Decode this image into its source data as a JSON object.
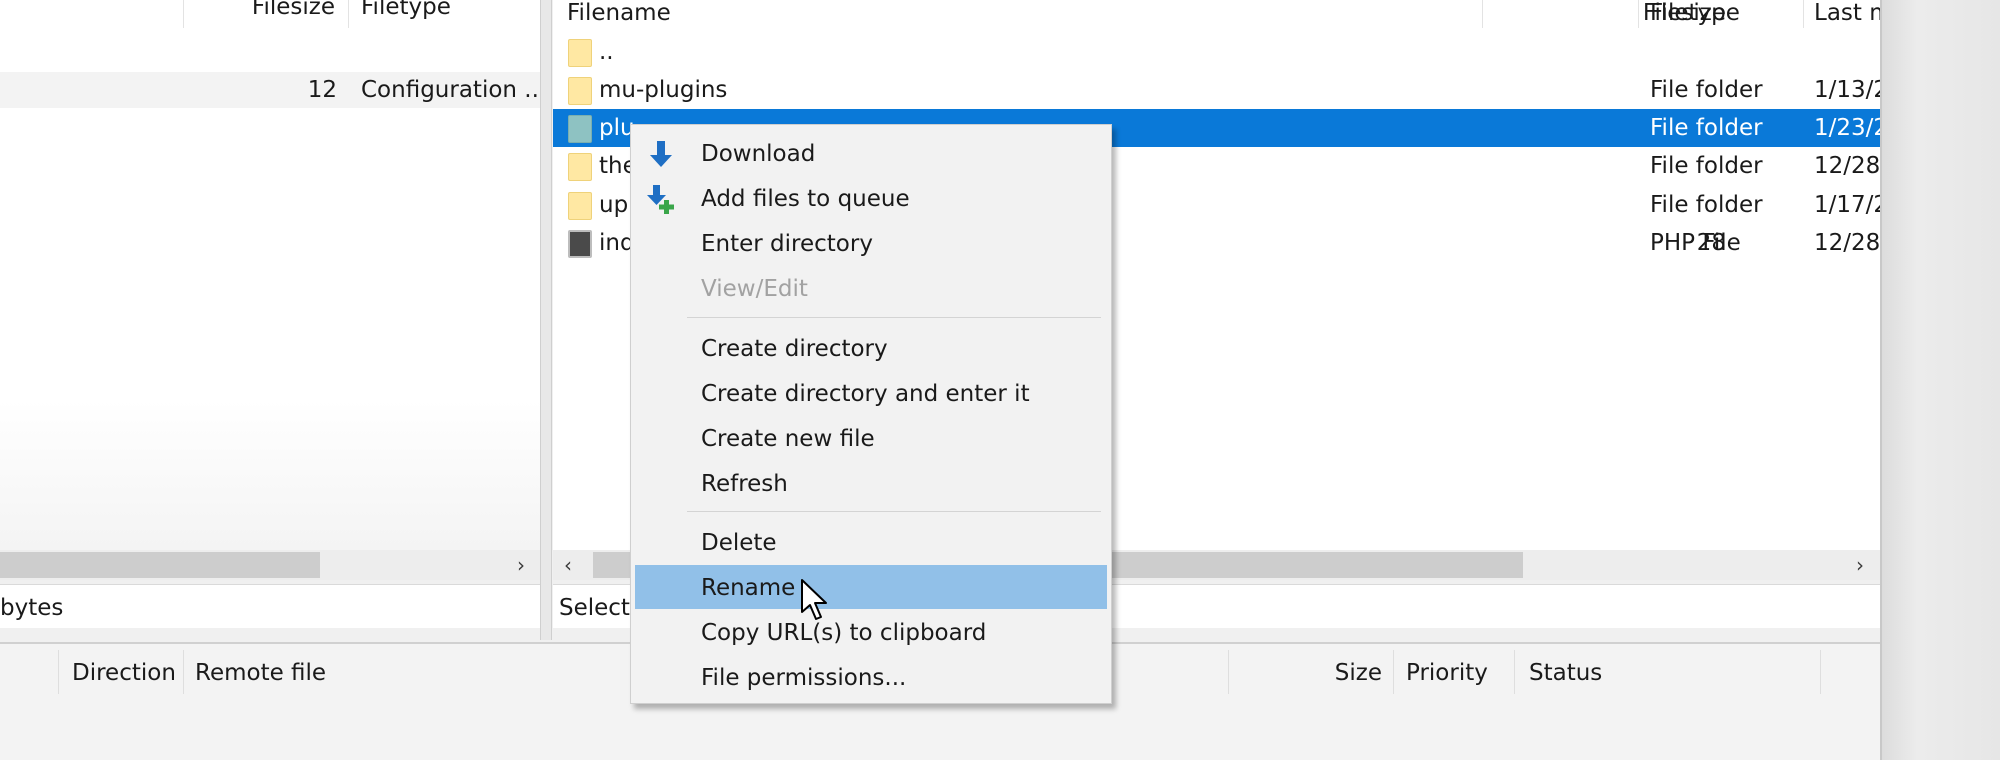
{
  "local_pane": {
    "columns": {
      "filesize": "Filesize",
      "filetype": "Filetype"
    },
    "row": {
      "filesize": "12",
      "filetype": "Configuration ..."
    },
    "status": "bytes"
  },
  "remote_pane": {
    "columns": {
      "filename": "Filename",
      "filesize": "Filesize",
      "filetype": "Filetype",
      "last_modified": "Last m"
    },
    "rows": [
      {
        "name": "..",
        "size": "",
        "type": "",
        "date": "",
        "icon": "folder-icon"
      },
      {
        "name": "mu-plugins",
        "size": "",
        "type": "File folder",
        "date": "1/13/2",
        "icon": "folder-icon"
      },
      {
        "name": "plu",
        "size": "",
        "type": "File folder",
        "date": "1/23/2",
        "icon": "folder-icon",
        "selected": true
      },
      {
        "name": "the",
        "size": "",
        "type": "File folder",
        "date": "12/28/",
        "icon": "folder-icon"
      },
      {
        "name": "up",
        "size": "",
        "type": "File folder",
        "date": "1/17/2",
        "icon": "folder-icon"
      },
      {
        "name": "ind",
        "size": "28",
        "type": "PHP File",
        "date": "12/28/",
        "icon": "php-file-icon"
      }
    ],
    "status": "Selecte"
  },
  "queue": {
    "columns": {
      "direction": "Direction",
      "remote_file": "Remote file",
      "size": "Size",
      "priority": "Priority",
      "status": "Status"
    }
  },
  "context_menu": {
    "items": {
      "download": "Download",
      "add_to_queue": "Add files to queue",
      "enter_directory": "Enter directory",
      "view_edit": "View/Edit",
      "create_directory": "Create directory",
      "create_directory_enter": "Create directory and enter it",
      "create_new_file": "Create new file",
      "refresh": "Refresh",
      "delete": "Delete",
      "rename": "Rename",
      "copy_url": "Copy URL(s) to clipboard",
      "file_permissions": "File permissions..."
    },
    "hovered": "rename",
    "disabled": [
      "view_edit"
    ]
  },
  "colors": {
    "selection": "#0a79d8",
    "menu_hover": "#91c0e8",
    "folder": "#ffe8a3",
    "download_arrow": "#1f6fc4",
    "queue_plus": "#3aa64a"
  }
}
